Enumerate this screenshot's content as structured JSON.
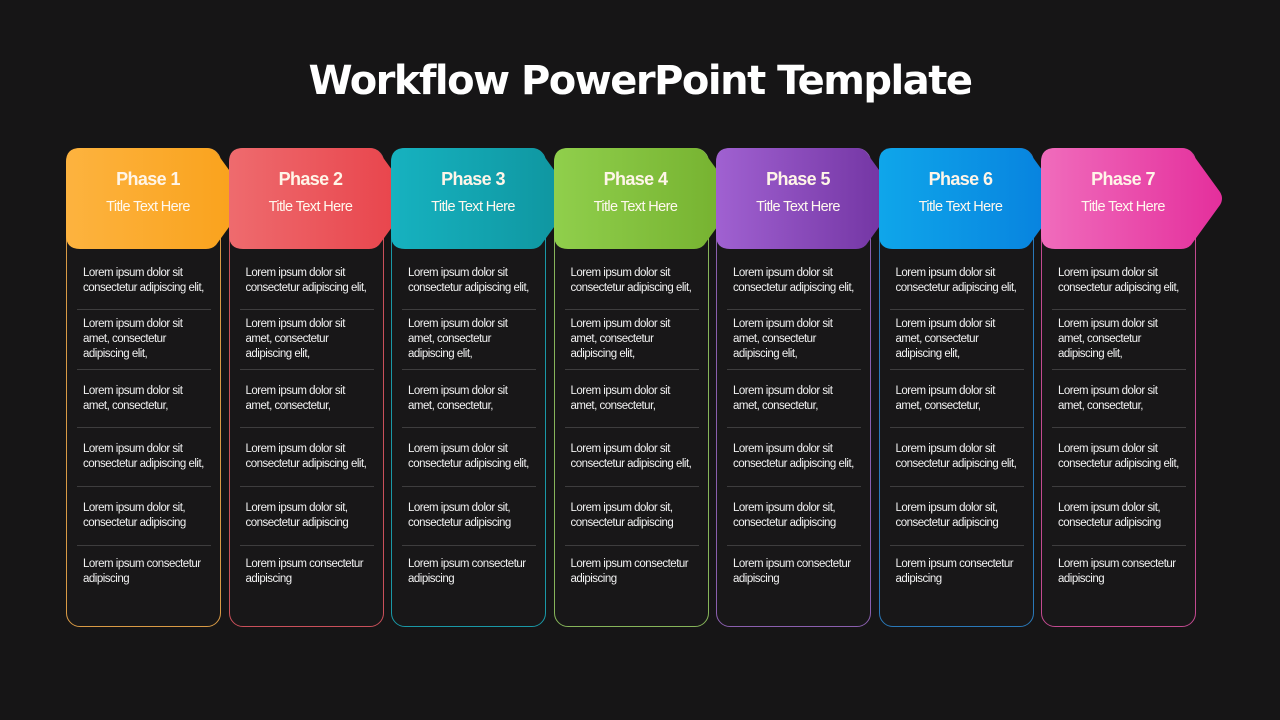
{
  "title": "Workflow PowerPoint Template",
  "phases": [
    {
      "label": "Phase 1",
      "subtitle": "Title Text Here",
      "colors": {
        "start": "#fdb33f",
        "end": "#f9a11a",
        "border": "#d99a45"
      },
      "items": [
        "Lorem ipsum dolor sit consectetur adipiscing elit,",
        "Lorem ipsum dolor sit amet, consectetur adipiscing elit,",
        "Lorem ipsum dolor sit amet, consectetur,",
        "Lorem ipsum dolor sit consectetur adipiscing elit,",
        "Lorem ipsum dolor sit, consectetur adipiscing",
        "Lorem ipsum consectetur adipiscing"
      ]
    },
    {
      "label": "Phase 2",
      "subtitle": "Title Text Here",
      "colors": {
        "start": "#ee6b6e",
        "end": "#e8424a",
        "border": "#c9505a"
      },
      "items": [
        "Lorem ipsum dolor sit consectetur adipiscing elit,",
        "Lorem ipsum dolor sit amet, consectetur adipiscing elit,",
        "Lorem ipsum dolor sit amet, consectetur,",
        "Lorem ipsum dolor sit consectetur adipiscing elit,",
        "Lorem ipsum dolor sit, consectetur adipiscing",
        "Lorem ipsum consectetur adipiscing"
      ]
    },
    {
      "label": "Phase 3",
      "subtitle": "Title Text Here",
      "colors": {
        "start": "#16b2c0",
        "end": "#0f949e",
        "border": "#1a98a6"
      },
      "items": [
        "Lorem ipsum dolor sit consectetur adipiscing elit,",
        "Lorem ipsum dolor sit amet, consectetur adipiscing elit,",
        "Lorem ipsum dolor sit amet, consectetur,",
        "Lorem ipsum dolor sit consectetur adipiscing elit,",
        "Lorem ipsum dolor sit, consectetur adipiscing",
        "Lorem ipsum consectetur adipiscing"
      ]
    },
    {
      "label": "Phase 4",
      "subtitle": "Title Text Here",
      "colors": {
        "start": "#90cf4c",
        "end": "#74b02e",
        "border": "#86b45a"
      },
      "items": [
        "Lorem ipsum dolor sit consectetur adipiscing elit,",
        "Lorem ipsum dolor sit amet, consectetur adipiscing elit,",
        "Lorem ipsum dolor sit amet, consectetur,",
        "Lorem ipsum dolor sit consectetur adipiscing elit,",
        "Lorem ipsum dolor sit, consectetur adipiscing",
        "Lorem ipsum consectetur adipiscing"
      ]
    },
    {
      "label": "Phase 5",
      "subtitle": "Title Text Here",
      "colors": {
        "start": "#a061d1",
        "end": "#7032a0",
        "border": "#8a5fae"
      },
      "items": [
        "Lorem ipsum dolor sit consectetur adipiscing elit,",
        "Lorem ipsum dolor sit amet, consectetur adipiscing elit,",
        "Lorem ipsum dolor sit amet, consectetur,",
        "Lorem ipsum dolor sit consectetur adipiscing elit,",
        "Lorem ipsum dolor sit, consectetur adipiscing",
        "Lorem ipsum consectetur adipiscing"
      ]
    },
    {
      "label": "Phase 6",
      "subtitle": "Title Text Here",
      "colors": {
        "start": "#0fa6ea",
        "end": "#0780de",
        "border": "#2a78b8"
      },
      "items": [
        "Lorem ipsum dolor sit consectetur adipiscing elit,",
        "Lorem ipsum dolor sit amet, consectetur adipiscing elit,",
        "Lorem ipsum dolor sit amet, consectetur,",
        "Lorem ipsum dolor sit consectetur adipiscing elit,",
        "Lorem ipsum dolor sit, consectetur adipiscing",
        "Lorem ipsum consectetur adipiscing"
      ]
    },
    {
      "label": "Phase 7",
      "subtitle": "Title Text Here",
      "colors": {
        "start": "#f06cbc",
        "end": "#e42f9c",
        "border": "#c24a90"
      },
      "items": [
        "Lorem ipsum dolor sit consectetur adipiscing elit,",
        "Lorem ipsum dolor sit amet, consectetur adipiscing elit,",
        "Lorem ipsum dolor sit amet, consectetur,",
        "Lorem ipsum dolor sit consectetur adipiscing elit,",
        "Lorem ipsum dolor sit, consectetur adipiscing",
        "Lorem ipsum consectetur adipiscing"
      ]
    }
  ]
}
